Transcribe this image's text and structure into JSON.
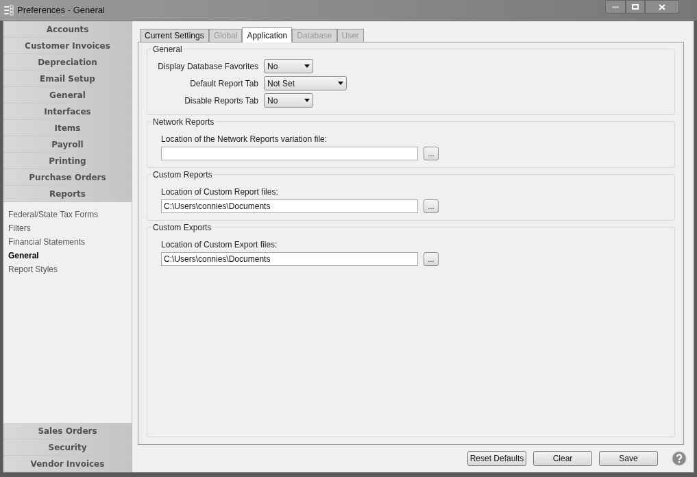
{
  "window": {
    "title": "Preferences - General"
  },
  "sidebar": {
    "top_categories": [
      "Accounts",
      "Customer Invoices",
      "Depreciation",
      "Email Setup",
      "General",
      "Interfaces",
      "Items",
      "Payroll",
      "Printing",
      "Purchase Orders",
      "Reports"
    ],
    "items": [
      {
        "label": "Federal/State Tax Forms",
        "selected": false
      },
      {
        "label": "Filters",
        "selected": false
      },
      {
        "label": "Financial Statements",
        "selected": false
      },
      {
        "label": "General",
        "selected": true
      },
      {
        "label": "Report Styles",
        "selected": false
      }
    ],
    "bottom_categories": [
      "Sales Orders",
      "Security",
      "Vendor Invoices"
    ]
  },
  "tabs": [
    {
      "label": "Current Settings",
      "selected": false,
      "disabled": false
    },
    {
      "label": "Global",
      "selected": false,
      "disabled": true
    },
    {
      "label": "Application",
      "selected": true,
      "disabled": false
    },
    {
      "label": "Database",
      "selected": false,
      "disabled": true
    },
    {
      "label": "User",
      "selected": false,
      "disabled": true
    }
  ],
  "sections": [
    {
      "kind": "dropdowns",
      "title": "General",
      "fields": [
        {
          "label": "Display Database Favorites",
          "value": "No",
          "wide": false
        },
        {
          "label": "Default Report Tab",
          "value": "Not Set",
          "wide": true
        },
        {
          "label": "Disable Reports Tab",
          "value": "No",
          "wide": false
        }
      ]
    },
    {
      "kind": "file",
      "title": "Network Reports",
      "label": "Location of the Network Reports variation file:",
      "button": "...",
      "grow": false
    },
    {
      "kind": "file",
      "title": "Custom Reports",
      "label": "Location of Custom Report files:",
      "value": "C:\\Users\\connies\\Documents",
      "button": "...",
      "grow": false
    },
    {
      "kind": "file",
      "title": "Custom Exports",
      "label": "Location of Custom Export files:",
      "value": "C:\\Users\\connies\\Documents",
      "button": "...",
      "grow": true
    }
  ],
  "buttons": [
    "Reset Defaults",
    "Clear",
    "Save"
  ]
}
